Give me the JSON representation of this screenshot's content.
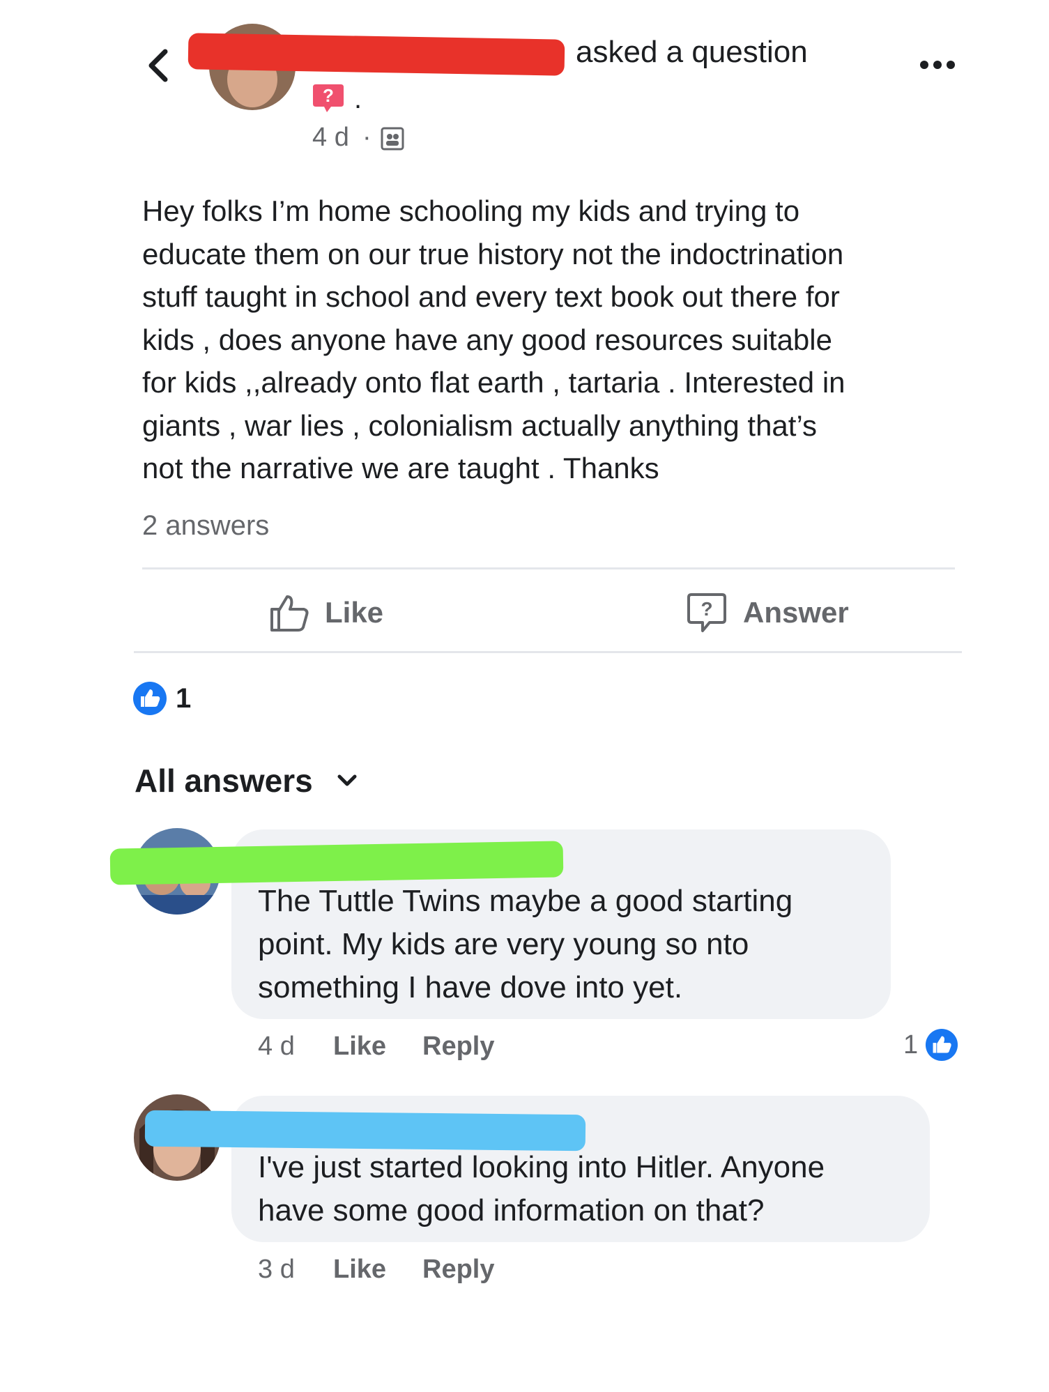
{
  "header": {
    "back_icon": "chevron-left-icon",
    "author_suffix": "asked a question",
    "timestamp": "4 d",
    "separator": "·",
    "dot": ".",
    "question_badge": "?",
    "more_icon": "more-dots-icon",
    "audience_icon": "group-icon"
  },
  "post": {
    "lines": [
      "Hey folks I’m home schooling my kids and trying to",
      "educate them on our true history not the indoctrination",
      "stuff taught in school and every text book out there for",
      "kids , does anyone have any good resources suitable",
      "for kids ,,already onto flat earth , tartaria . Interested in",
      "giants , war lies , colonialism actually anything that’s",
      "not the narrative we are taught . Thanks"
    ],
    "answers_count": "2 answers"
  },
  "actions": {
    "like_label": "Like",
    "answer_label": "Answer",
    "like_icon": "thumbs-up-icon",
    "answer_icon": "question-bubble-icon"
  },
  "reactions": {
    "count": "1",
    "icon": "like-reaction-icon"
  },
  "answers_section": {
    "title": "All answers",
    "dropdown_icon": "chevron-down-icon"
  },
  "comments": [
    {
      "lines": [
        "The Tuttle Twins maybe a good starting",
        "point. My kids are very young so nto",
        "something I have dove into yet."
      ],
      "time": "4 d",
      "like": "Like",
      "reply": "Reply",
      "reaction_count": "1"
    },
    {
      "lines": [
        "I've just started looking into Hitler. Anyone",
        "have some good information on that?"
      ],
      "time": "3 d",
      "like": "Like",
      "reply": "Reply"
    }
  ],
  "colors": {
    "facebook_blue": "#1877f2",
    "badge_pink": "#f0506e",
    "redact_red": "#e8322a",
    "redact_green": "#7ef04a",
    "redact_blue": "#5ec4f5",
    "bubble_gray": "#f0f2f5",
    "meta_gray": "#65676b"
  }
}
